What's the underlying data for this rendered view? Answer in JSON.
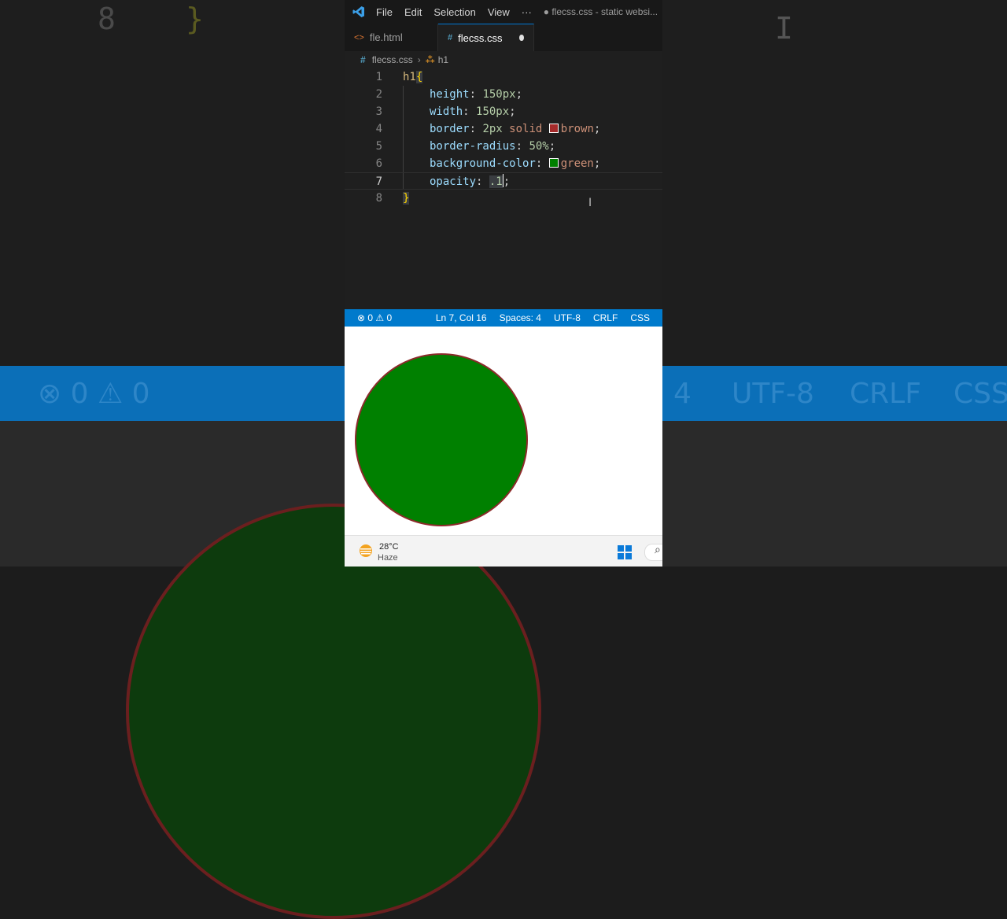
{
  "window": {
    "menu": [
      "File",
      "Edit",
      "Selection",
      "View",
      "···"
    ],
    "title": "● flecss.css - static websi..."
  },
  "tabs": [
    {
      "label": "fle.html",
      "icon": "html-icon",
      "active": false
    },
    {
      "label": "flecss.css",
      "icon": "css-icon",
      "active": true,
      "modified": true
    }
  ],
  "breadcrumb": {
    "file": "flecss.css",
    "symbol": "h1"
  },
  "editor": {
    "lines": [
      {
        "n": "1",
        "selector": "h1",
        "open": "{"
      },
      {
        "n": "2",
        "prop": "height",
        "value": "150px"
      },
      {
        "n": "3",
        "prop": "width",
        "value": "150px"
      },
      {
        "n": "4",
        "prop": "border",
        "value_num": "2px",
        "value_kw": "solid",
        "value_color": "brown",
        "swatch": "#a52a2a"
      },
      {
        "n": "5",
        "prop": "border-radius",
        "value": "50%"
      },
      {
        "n": "6",
        "prop": "background-color",
        "value_color": "green",
        "swatch": "#008000"
      },
      {
        "n": "7",
        "prop": "opacity",
        "value": ".1"
      },
      {
        "n": "8",
        "close": "}"
      }
    ]
  },
  "statusbar": {
    "errors": "0",
    "warnings": "0",
    "position": "Ln 7, Col 16",
    "spaces": "Spaces: 4",
    "encoding": "UTF-8",
    "eol": "CRLF",
    "language": "CSS"
  },
  "preview": {
    "shape": "h1 circle",
    "fill": "#008000",
    "border": "#8b2a2a"
  },
  "taskbar": {
    "temp": "28°C",
    "condition": "Haze"
  },
  "background": {
    "line_num": "8",
    "brace": "}",
    "status_left": "0 0",
    "status_right": [
      "4",
      "UTF-8",
      "CRLF",
      "CSS"
    ]
  }
}
